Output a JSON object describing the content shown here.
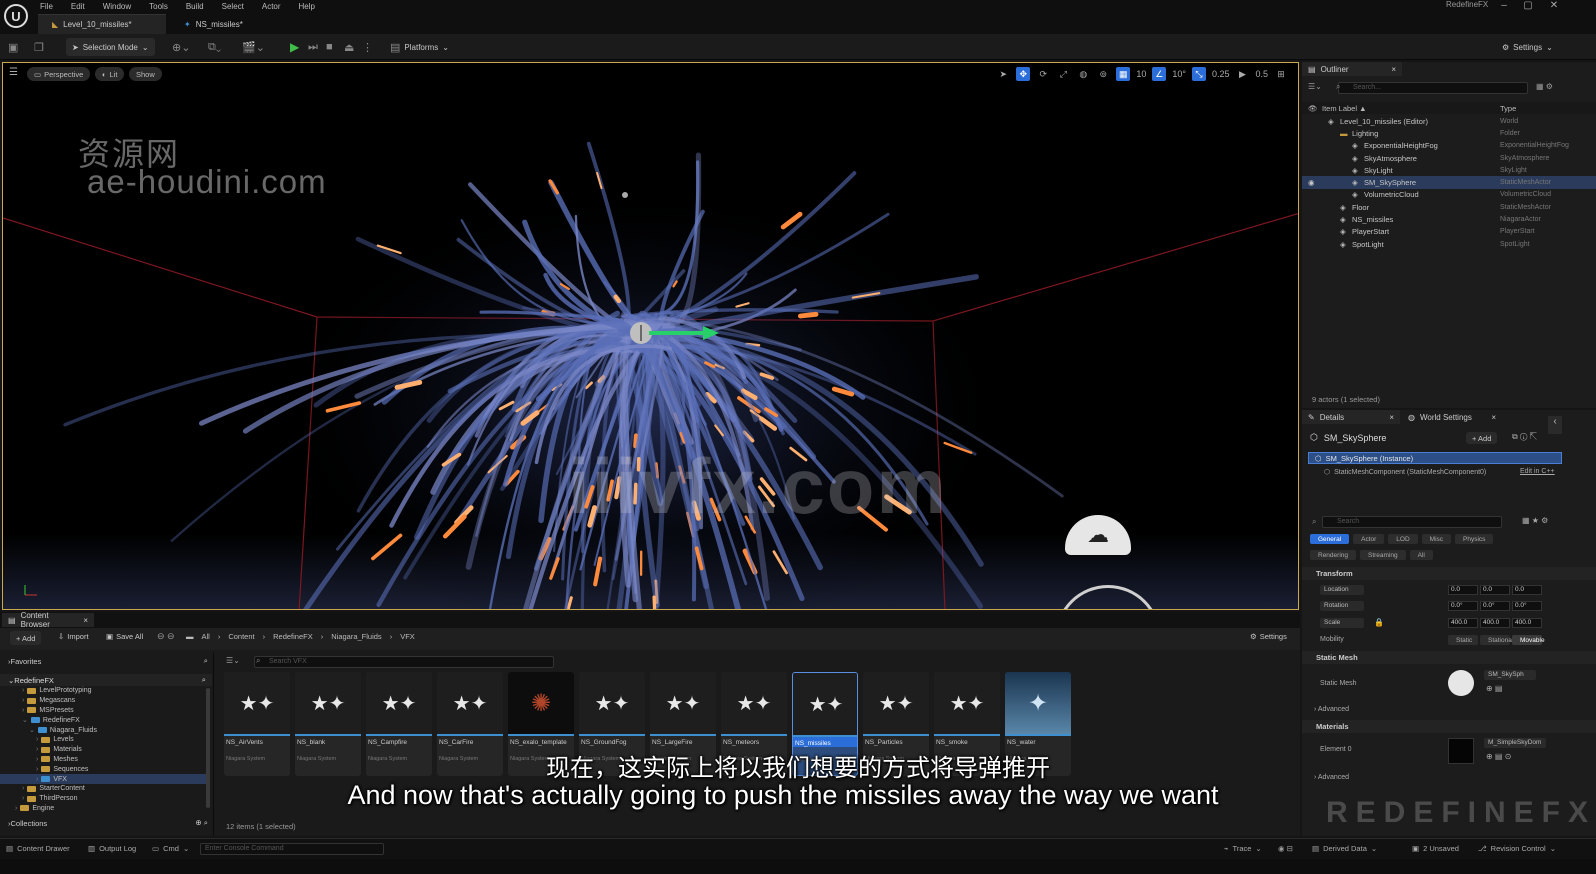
{
  "window": {
    "menu": [
      "File",
      "Edit",
      "Window",
      "Tools",
      "Build",
      "Select",
      "Actor",
      "Help"
    ],
    "tabs": [
      "Level_10_missiles*",
      "NS_missiles*"
    ],
    "app_name": "RedefineFX",
    "controls": [
      "–",
      "▢",
      "✕"
    ]
  },
  "toolbar": {
    "selection_mode": "Selection Mode",
    "platforms": "Platforms",
    "settings": "Settings"
  },
  "viewport": {
    "perspective": "Perspective",
    "lit": "Lit",
    "show": "Show",
    "grid_value": "10",
    "angle_value": "10°",
    "scale_value": "0.25",
    "camera_value": "0.5",
    "watermark_cn": "资源网",
    "watermark_url": "ae-houdini.com",
    "watermark_center": "iiivfx.com"
  },
  "outliner": {
    "tab": "Outliner",
    "search_placeholder": "Search...",
    "col_label": "Item Label ▲",
    "col_type": "Type",
    "items": [
      {
        "label": "Level_10_missiles (Editor)",
        "type": "World",
        "indent": 0
      },
      {
        "label": "Lighting",
        "type": "Folder",
        "indent": 1
      },
      {
        "label": "ExponentialHeightFog",
        "type": "ExponentialHeightFog",
        "indent": 2
      },
      {
        "label": "SkyAtmosphere",
        "type": "SkyAtmosphere",
        "indent": 2
      },
      {
        "label": "SkyLight",
        "type": "SkyLight",
        "indent": 2
      },
      {
        "label": "SM_SkySphere",
        "type": "StaticMeshActor",
        "indent": 2
      },
      {
        "label": "VolumetricCloud",
        "type": "VolumetricCloud",
        "indent": 2
      },
      {
        "label": "Floor",
        "type": "StaticMeshActor",
        "indent": 1
      },
      {
        "label": "NS_missiles",
        "type": "NiagaraActor",
        "indent": 1
      },
      {
        "label": "PlayerStart",
        "type": "PlayerStart",
        "indent": 1
      },
      {
        "label": "SpotLight",
        "type": "SpotLight",
        "indent": 1
      }
    ],
    "footer": "9 actors (1 selected)"
  },
  "details": {
    "tab": "Details",
    "tab2": "World Settings",
    "actor": "SM_SkySphere",
    "add": "+ Add",
    "instance": "SM_SkySphere (Instance)",
    "component": "StaticMeshComponent (StaticMeshComponent0)",
    "edit_cpp": "Edit in C++",
    "search_placeholder": "Search",
    "filters": [
      "General",
      "Actor",
      "LOD",
      "Misc",
      "Physics",
      "Rendering",
      "Streaming",
      "All"
    ],
    "transform_head": "Transform",
    "location": "Location",
    "rotation": "Rotation",
    "scale": "Scale",
    "mobility": "Mobility",
    "loc_vals": [
      "0.0",
      "0.0",
      "0.0"
    ],
    "rot_vals": [
      "0.0°",
      "0.0°",
      "0.0°"
    ],
    "scale_vals": [
      "400.0",
      "400.0",
      "400.0"
    ],
    "mobility_opts": [
      "Static",
      "Stationary",
      "Movable"
    ],
    "static_mesh_head": "Static Mesh",
    "static_mesh_label": "Static Mesh",
    "static_mesh_value": "SM_SkySph",
    "advanced": "Advanced",
    "materials_head": "Materials",
    "element0": "Element 0",
    "material_value": "M_SimpleSkyDom",
    "advanced2": "Advanced",
    "brand_watermark": "REDEFINEFX"
  },
  "content_browser": {
    "tab": "Content Browser",
    "add": "+ Add",
    "import": "Import",
    "save_all": "Save All",
    "breadcrumb": [
      "All",
      "Content",
      "RedefineFX",
      "Niagara_Fluids",
      "VFX"
    ],
    "settings": "Settings",
    "search_placeholder": "Search VFX",
    "favorites": "Favorites",
    "root": "RedefineFX",
    "folders": [
      {
        "name": "LevelPrototyping",
        "indent": 2
      },
      {
        "name": "Megascans",
        "indent": 2
      },
      {
        "name": "MSPresets",
        "indent": 2
      },
      {
        "name": "RedefineFX",
        "indent": 2
      },
      {
        "name": "Niagara_Fluids",
        "indent": 3
      },
      {
        "name": "Levels",
        "indent": 4
      },
      {
        "name": "Materials",
        "indent": 4
      },
      {
        "name": "Meshes",
        "indent": 4
      },
      {
        "name": "Sequences",
        "indent": 4
      },
      {
        "name": "VFX",
        "indent": 4
      },
      {
        "name": "StarterContent",
        "indent": 2
      },
      {
        "name": "ThirdPerson",
        "indent": 2
      },
      {
        "name": "Engine",
        "indent": 1
      }
    ],
    "collections": "Collections",
    "item_count": "12 items (1 selected)",
    "assets": [
      {
        "name": "NS_AirVents",
        "type": "Niagara System"
      },
      {
        "name": "NS_blank",
        "type": "Niagara System"
      },
      {
        "name": "NS_Campfire",
        "type": "Niagara System"
      },
      {
        "name": "NS_CarFire",
        "type": "Niagara System"
      },
      {
        "name": "NS_exalo_template",
        "type": "Niagara System"
      },
      {
        "name": "NS_GroundFog",
        "type": "Niagara System"
      },
      {
        "name": "NS_LargeFire",
        "type": "Niagara System"
      },
      {
        "name": "NS_meteors",
        "type": "Niagara System"
      },
      {
        "name": "NS_missiles",
        "type": "Niagara System"
      },
      {
        "name": "NS_Particles",
        "type": "Niagara System"
      },
      {
        "name": "NS_smoke",
        "type": "Niagara System"
      },
      {
        "name": "NS_water",
        "type": "Niagara System"
      }
    ]
  },
  "subtitles": {
    "cn": "现在，这实际上将以我们想要的方式将导弹推开",
    "en": "And now that's actually going to push the missiles away the way we want"
  },
  "statusbar": {
    "content_drawer": "Content Drawer",
    "output_log": "Output Log",
    "cmd": "Cmd",
    "console_placeholder": "Enter Console Command",
    "trace": "Trace",
    "derived_data": "Derived Data",
    "unsaved": "2 Unsaved",
    "revision": "Revision Control"
  },
  "colors": {
    "accent": "#2c6ed9",
    "play": "#3fbf4a",
    "viewport_border": "#caa850",
    "folder": "#c59a3c"
  }
}
